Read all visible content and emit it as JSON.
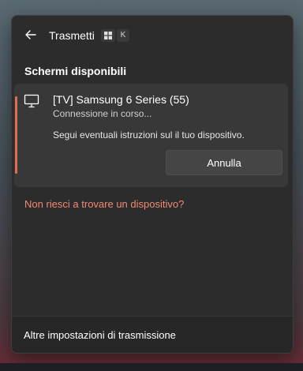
{
  "header": {
    "title": "Trasmetti",
    "shortcut_key": "K"
  },
  "section": {
    "title": "Schermi disponibili"
  },
  "device": {
    "name": "[TV] Samsung 6 Series (55)",
    "status": "Connessione in corso...",
    "hint": "Segui eventuali istruzioni sul il tuo dispositivo.",
    "cancel_label": "Annulla"
  },
  "help_link": "Non riesci a trovare un dispositivo?",
  "footer": {
    "settings_link": "Altre impostazioni di trasmissione"
  },
  "colors": {
    "accent": "#e26c57",
    "link": "#f08a74",
    "flyout_bg": "#2c2c2c",
    "card_bg": "#383838"
  },
  "icons": {
    "back": "arrow-left-icon",
    "windows_key": "windows-logo-icon",
    "device": "monitor-icon"
  }
}
